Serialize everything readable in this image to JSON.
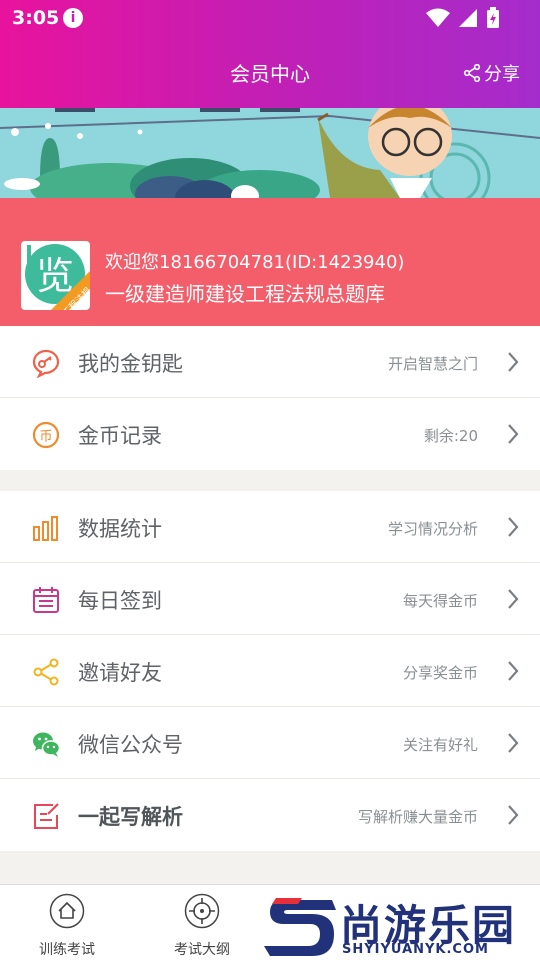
{
  "status_bar": {
    "time": "3:05"
  },
  "header": {
    "title": "会员中心",
    "share_label": "分享"
  },
  "profile": {
    "welcome": "欢迎您18166704781(ID:1423940)",
    "bank_name": "一级建造师建设工程法规总题库",
    "avatar_char": "览",
    "avatar_tag": "工程法规"
  },
  "menu_group_1": [
    {
      "label": "我的金钥匙",
      "hint": "开启智慧之门",
      "icon": "key-icon"
    },
    {
      "label": "金币记录",
      "hint": "剩余:20",
      "icon": "coin-icon"
    }
  ],
  "menu_group_2": [
    {
      "label": "数据统计",
      "hint": "学习情况分析",
      "icon": "bar-chart-icon"
    },
    {
      "label": "每日签到",
      "hint": "每天得金币",
      "icon": "calendar-icon"
    },
    {
      "label": "邀请好友",
      "hint": "分享奖金币",
      "icon": "share-icon"
    },
    {
      "label": "微信公众号",
      "hint": "关注有好礼",
      "icon": "wechat-icon"
    },
    {
      "label": "一起写解析",
      "hint": "写解析赚大量金币",
      "icon": "edit-icon"
    }
  ],
  "bottom_nav": [
    {
      "label": "训练考试",
      "icon": "home-icon"
    },
    {
      "label": "考试大纲",
      "icon": "target-icon"
    }
  ],
  "watermark": {
    "title": "尚游乐园",
    "url": "SHYIYUANYK.COM"
  },
  "colors": {
    "header_gradient_start": "#e8139d",
    "header_gradient_end": "#a52ccc",
    "profile_bg": "#f35e6a"
  }
}
